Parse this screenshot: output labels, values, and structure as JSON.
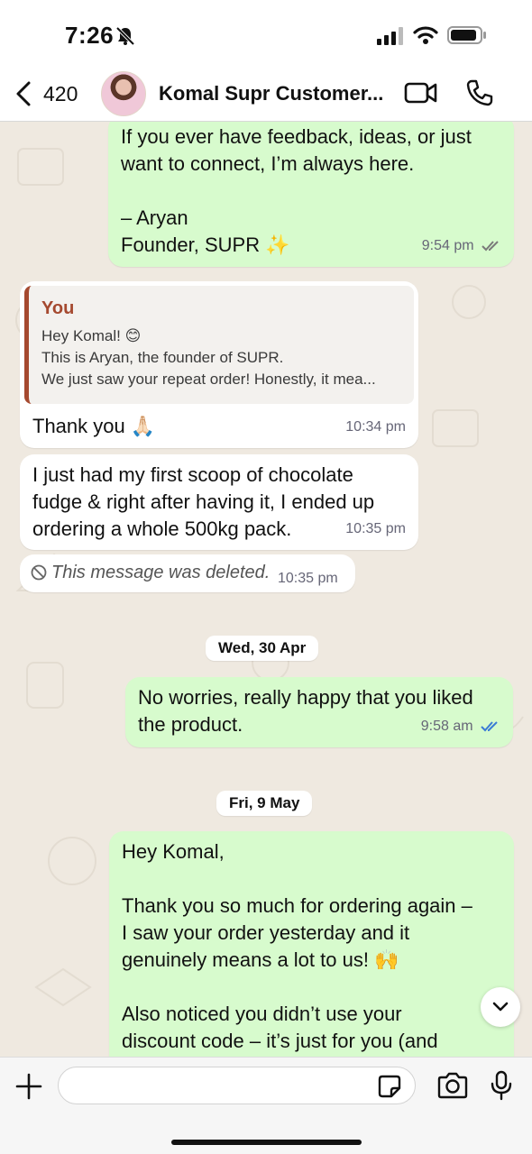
{
  "status_bar": {
    "time": "7:26"
  },
  "header": {
    "back_count": "420",
    "contact_name": "Komal Supr Customer..."
  },
  "messages": [
    {
      "id": "m1",
      "direction": "outgoing",
      "text": "If you ever have feedback, ideas, or just\nwant to connect, I’m always here.\n\n– Aryan\nFounder, SUPR ✨",
      "time": "9:54 pm",
      "read_status": "read-grey"
    },
    {
      "id": "m2",
      "direction": "incoming",
      "quote": {
        "author": "You",
        "lines": [
          "Hey Komal! 😊",
          "This is Aryan, the founder of SUPR.",
          "We just saw your repeat order! Honestly, it mea..."
        ]
      },
      "text": "Thank you 🙏🏻",
      "time": "10:34 pm"
    },
    {
      "id": "m3",
      "direction": "incoming",
      "text": "I just had my first scoop of chocolate\nfudge & right after having it, I ended up\nordering a whole 500kg pack.",
      "time": "10:35 pm"
    },
    {
      "id": "m4",
      "direction": "incoming",
      "deleted": true,
      "text": "This message was deleted.",
      "time": "10:35 pm"
    },
    {
      "id": "d1",
      "type": "date",
      "label": "Wed, 30 Apr"
    },
    {
      "id": "m5",
      "direction": "outgoing",
      "text": "No worries, really happy that you liked\nthe product.",
      "time": "9:58 am",
      "read_status": "read-blue"
    },
    {
      "id": "d2",
      "type": "date",
      "label": "Fri, 9 May"
    },
    {
      "id": "m6",
      "direction": "outgoing",
      "text": "Hey Komal,\n\nThank you so much for ordering again –\nI saw your order yesterday and it\ngenuinely means a lot to us! 🙌\n\nAlso noticed you didn’t use your\ndiscount code – it’s just for you (and"
    }
  ],
  "composer": {
    "placeholder": ""
  },
  "colors": {
    "outgoing_bubble": "#d7fbcd",
    "incoming_bubble": "#ffffff",
    "quote_accent": "#a5492f",
    "read_blue": "#3a7bd5",
    "wallpaper": "#efe9e0"
  },
  "icons": [
    "bell-slash-icon",
    "signal-icon",
    "wifi-icon",
    "battery-icon",
    "chevron-left-icon",
    "video-call-icon",
    "phone-icon",
    "ban-icon",
    "double-check-icon",
    "chevron-down-icon",
    "plus-icon",
    "sticker-icon",
    "camera-icon",
    "microphone-icon"
  ]
}
